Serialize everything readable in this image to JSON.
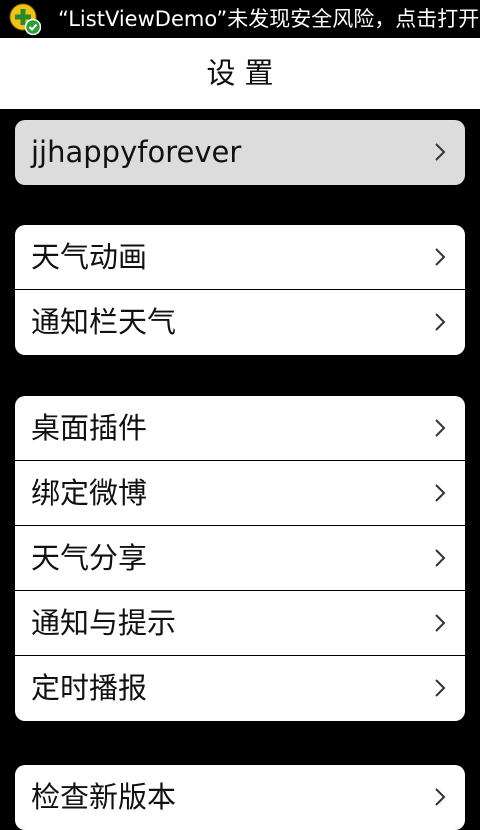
{
  "status_bar": {
    "notification_text": "“ListViewDemo”未发现安全风险，点击打开",
    "app_icon": "security-shield-plus-icon"
  },
  "title_bar": {
    "title": "设置"
  },
  "groups": [
    {
      "items": [
        {
          "label": "jjhappyforever",
          "icon": "chevron-right-icon"
        }
      ]
    },
    {
      "items": [
        {
          "label": "天气动画",
          "icon": "chevron-right-icon"
        },
        {
          "label": "通知栏天气",
          "icon": "chevron-right-icon"
        }
      ]
    },
    {
      "items": [
        {
          "label": "桌面插件",
          "icon": "chevron-right-icon"
        },
        {
          "label": "绑定微博",
          "icon": "chevron-right-icon"
        },
        {
          "label": "天气分享",
          "icon": "chevron-right-icon"
        },
        {
          "label": "通知与提示",
          "icon": "chevron-right-icon"
        },
        {
          "label": "定时播报",
          "icon": "chevron-right-icon"
        }
      ]
    },
    {
      "items": [
        {
          "label": "检查新版本",
          "icon": "chevron-right-icon"
        }
      ]
    }
  ],
  "colors": {
    "background": "#000000",
    "title_bar": "#ffffff",
    "account_row": "#dcdcdc",
    "list_row": "#ffffff",
    "chevron": "#333333"
  }
}
